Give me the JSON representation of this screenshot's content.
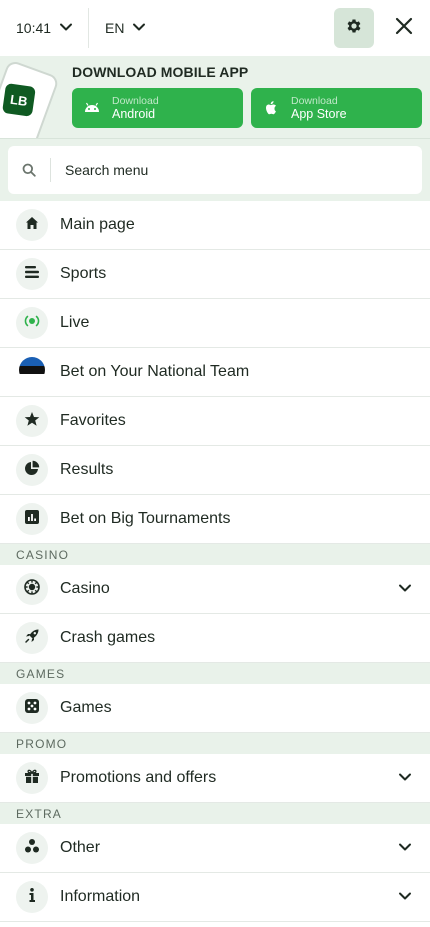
{
  "header": {
    "time": "10:41",
    "language": "EN"
  },
  "banner": {
    "title": "DOWNLOAD MOBILE APP",
    "logo_text": "LB",
    "android": {
      "small": "Download",
      "big": "Android"
    },
    "apple": {
      "small": "Download",
      "big": "App Store"
    }
  },
  "search": {
    "placeholder": "Search menu"
  },
  "menu": {
    "main": [
      {
        "label": "Main page",
        "icon": "home-icon"
      },
      {
        "label": "Sports",
        "icon": "sports-lines-icon"
      },
      {
        "label": "Live",
        "icon": "live-broadcast-icon"
      },
      {
        "label": "Bet on Your National Team",
        "icon": "estonia-flag-icon"
      },
      {
        "label": "Favorites",
        "icon": "star-icon"
      },
      {
        "label": "Results",
        "icon": "pie-chart-icon"
      },
      {
        "label": "Bet on Big Tournaments",
        "icon": "bar-chart-icon"
      }
    ],
    "casino_header": "CASINO",
    "casino": [
      {
        "label": "Casino",
        "icon": "casino-chip-icon"
      },
      {
        "label": "Crash games",
        "icon": "rocket-icon"
      }
    ],
    "games_header": "GAMES",
    "games": [
      {
        "label": "Games",
        "icon": "dice-icon"
      }
    ],
    "promo_header": "PROMO",
    "promo": [
      {
        "label": "Promotions and offers",
        "icon": "gift-icon"
      }
    ],
    "extra_header": "EXTRA",
    "extra": [
      {
        "label": "Other",
        "icon": "three-dots-cluster-icon"
      },
      {
        "label": "Information",
        "icon": "info-icon"
      }
    ]
  },
  "colors": {
    "accent_green": "#2fb24c",
    "banner_bg": "#e9f2ea",
    "gear_bg": "#d6e5d8",
    "logo_green": "#0f5a22"
  }
}
